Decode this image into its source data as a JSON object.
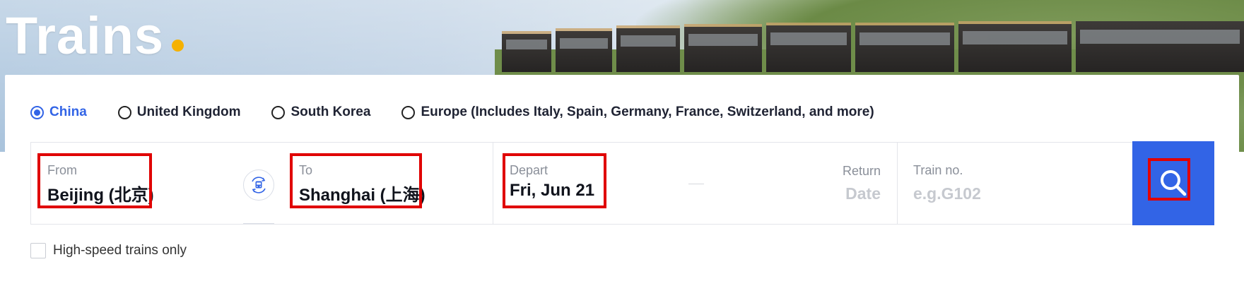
{
  "hero": {
    "title": "Trains"
  },
  "regions": [
    {
      "label": "China",
      "selected": true
    },
    {
      "label": "United Kingdom",
      "selected": false
    },
    {
      "label": "South Korea",
      "selected": false
    },
    {
      "label": "Europe (Includes Italy, Spain, Germany, France, Switzerland, and more)",
      "selected": false
    }
  ],
  "search": {
    "from": {
      "label": "From",
      "value": "Beijing (北京)"
    },
    "to": {
      "label": "To",
      "value": "Shanghai (上海)"
    },
    "depart": {
      "label": "Depart",
      "value": "Fri, Jun 21"
    },
    "return": {
      "label": "Return",
      "value": "Date"
    },
    "train_no": {
      "label": "Train no.",
      "placeholder": "e.g.G102",
      "value": ""
    },
    "swap_icon": "train-swap-icon",
    "search_icon": "search-icon"
  },
  "options": {
    "high_speed_label": "High-speed trains only",
    "high_speed_checked": false
  },
  "colors": {
    "accent": "#3264e6",
    "highlight": "#e00000",
    "hero_dot": "#f5b100"
  }
}
